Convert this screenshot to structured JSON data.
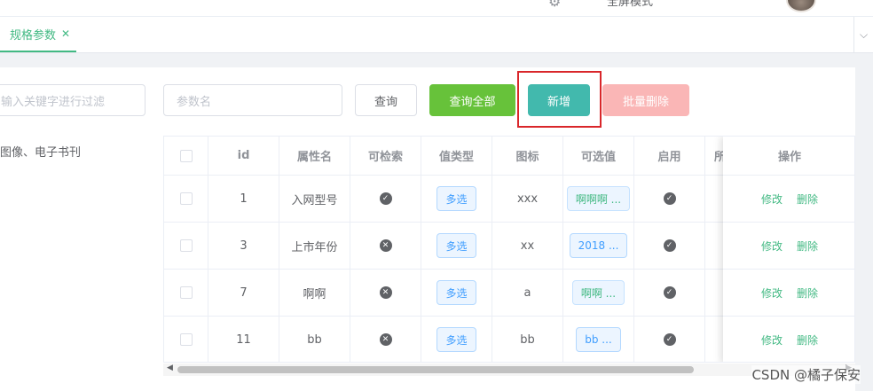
{
  "topbar": {
    "gear_icon": "gear-icon",
    "fullscreen_label": "全屏模式"
  },
  "tabs": [
    {
      "label": "规格参数",
      "close": "✕"
    }
  ],
  "tree": {
    "filter_placeholder": "输入关键字进行过滤",
    "node_label": "图像、电子书刊"
  },
  "search": {
    "param_placeholder": "参数名"
  },
  "buttons": {
    "query": "查询",
    "query_all": "查询全部",
    "add": "新增",
    "batch_delete": "批量删除"
  },
  "table": {
    "columns": [
      "",
      "id",
      "属性名",
      "可检索",
      "值类型",
      "图标",
      "可选值",
      "启用",
      "所",
      "操作"
    ],
    "rows": [
      {
        "id": "1",
        "name": "入网型号",
        "searchable": "yes",
        "value_type": "多选",
        "icon": "xxx",
        "options": "啊啊啊 ...",
        "enabled": "yes"
      },
      {
        "id": "3",
        "name": "上市年份",
        "searchable": "no",
        "value_type": "多选",
        "icon": "xx",
        "options": "2018 ...",
        "enabled": "yes"
      },
      {
        "id": "7",
        "name": "啊啊",
        "searchable": "no",
        "value_type": "多选",
        "icon": "a",
        "options": "啊啊 ...",
        "enabled": "yes"
      },
      {
        "id": "11",
        "name": "bb",
        "searchable": "no",
        "value_type": "多选",
        "icon": "bb",
        "options": "bb ...",
        "enabled": "yes"
      }
    ],
    "actions": {
      "edit": "修改",
      "delete": "删除"
    }
  },
  "watermark": "CSDN @橘子保安",
  "colors": {
    "accent": "#42b983",
    "success": "#67c23a",
    "danger_light": "#fab6b6",
    "highlight": "#d9262a"
  }
}
